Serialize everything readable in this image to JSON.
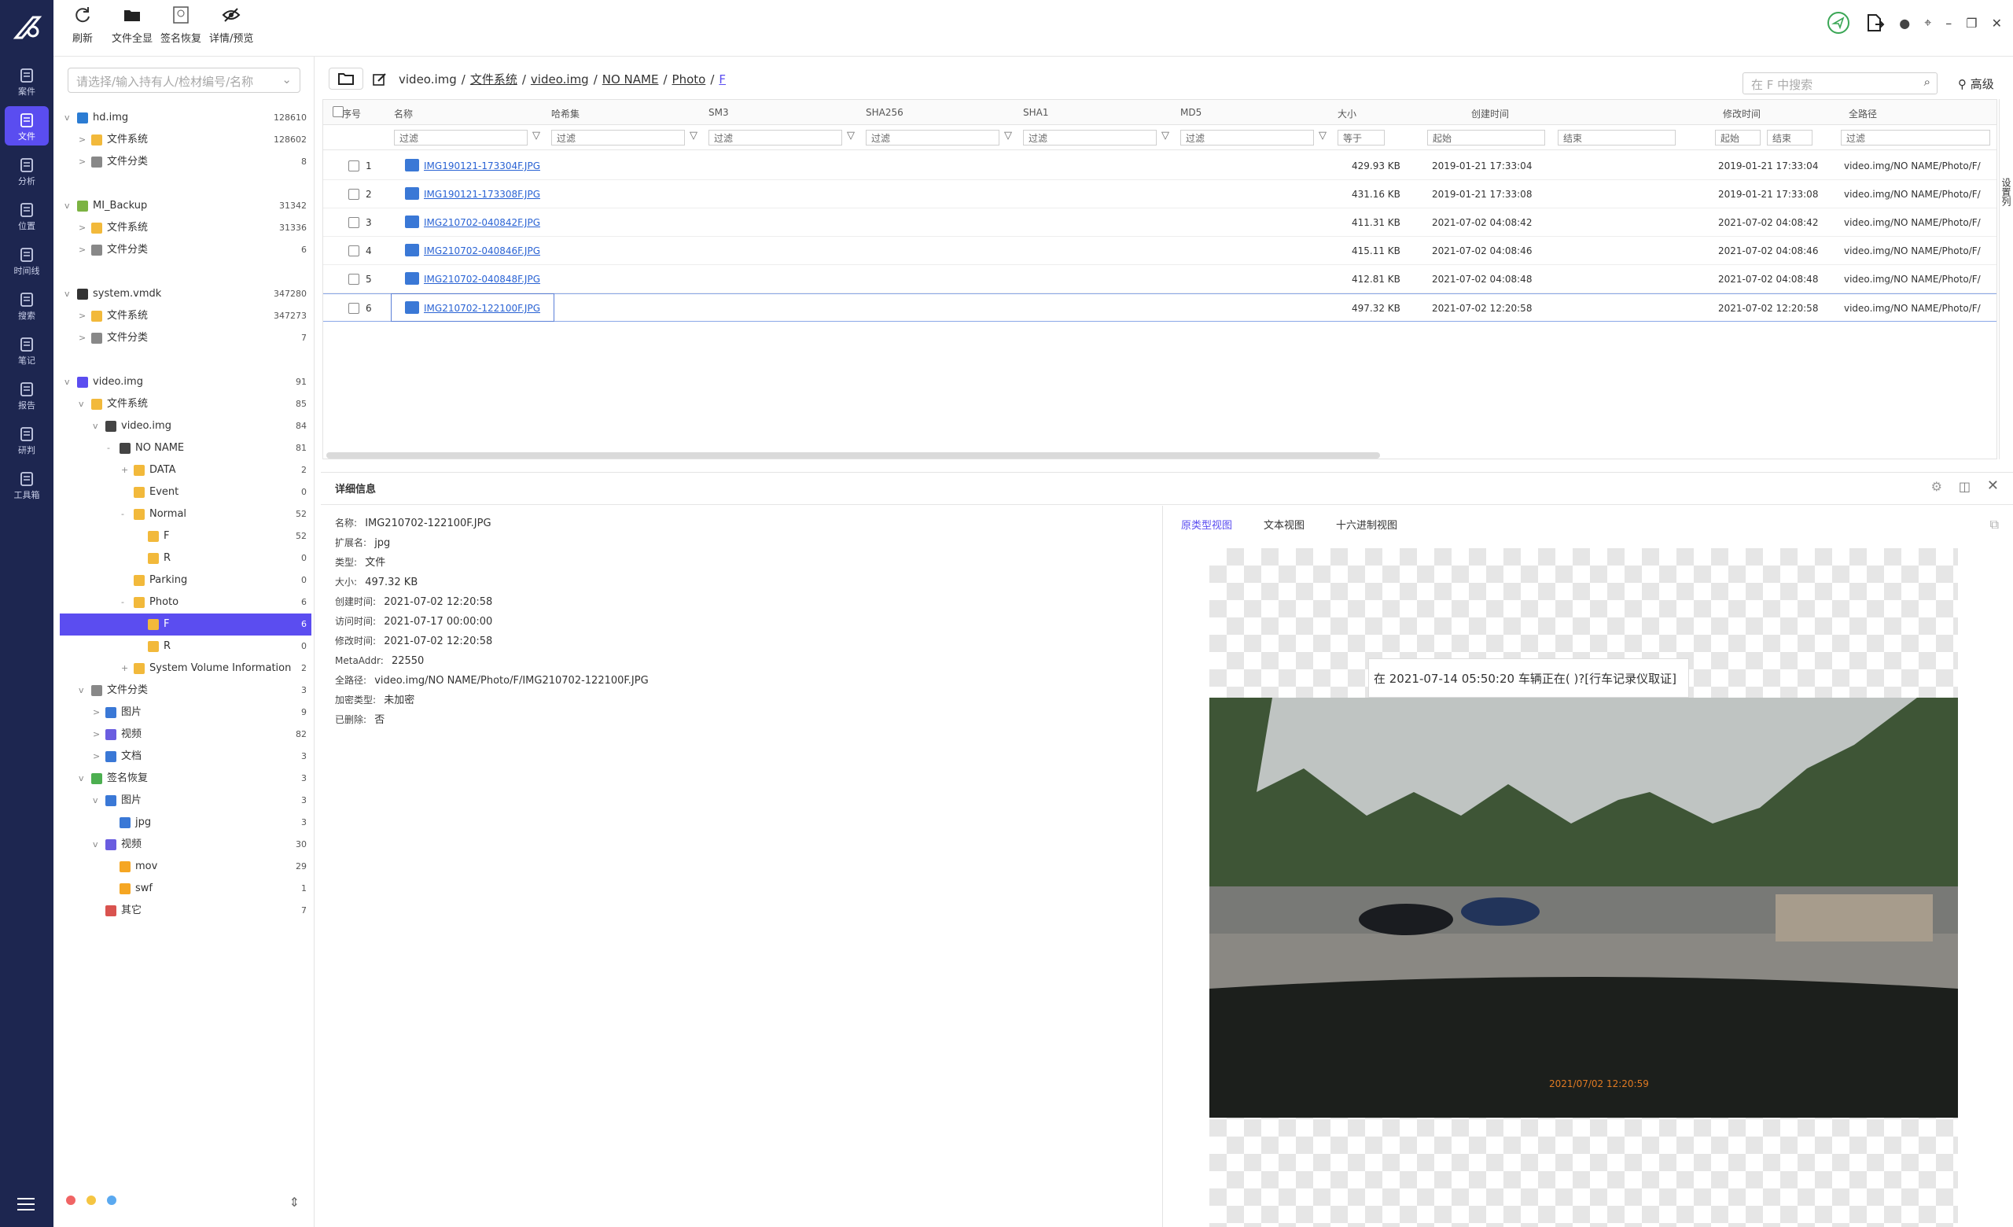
{
  "nav": [
    {
      "label": "案件",
      "icon": "case-icon"
    },
    {
      "label": "文件",
      "icon": "file-icon",
      "active": true
    },
    {
      "label": "分析",
      "icon": "analyze-icon"
    },
    {
      "label": "位置",
      "icon": "location-icon"
    },
    {
      "label": "时间线",
      "icon": "timeline-icon"
    },
    {
      "label": "搜索",
      "icon": "search-icon"
    },
    {
      "label": "笔记",
      "icon": "note-icon"
    },
    {
      "label": "报告",
      "icon": "report-icon"
    },
    {
      "label": "研判",
      "icon": "judge-icon"
    },
    {
      "label": "工具箱",
      "icon": "toolbox-icon"
    }
  ],
  "toolbar": {
    "refresh": "刷新",
    "show_all": "文件全显",
    "sig_recover": "签名恢复",
    "detail_preview": "详情/预览"
  },
  "side": {
    "placeholder": "请选择/输入持有人/检材编号/名称",
    "tree": [
      {
        "label": "hd.img",
        "count": "128610",
        "indent": 0,
        "tg": "v",
        "icon": "win"
      },
      {
        "label": "文件系统",
        "count": "128602",
        "indent": 1,
        "tg": ">",
        "icon": "folder"
      },
      {
        "label": "文件分类",
        "count": "8",
        "indent": 1,
        "tg": ">",
        "icon": "doc"
      },
      {
        "label": "",
        "count": "",
        "indent": 0,
        "tg": "",
        "icon": ""
      },
      {
        "label": "MI_Backup",
        "count": "31342",
        "indent": 0,
        "tg": "v",
        "icon": "android"
      },
      {
        "label": "文件系统",
        "count": "31336",
        "indent": 1,
        "tg": ">",
        "icon": "folder"
      },
      {
        "label": "文件分类",
        "count": "6",
        "indent": 1,
        "tg": ">",
        "icon": "doc"
      },
      {
        "label": "",
        "count": "",
        "indent": 0,
        "tg": "",
        "icon": ""
      },
      {
        "label": "system.vmdk",
        "count": "347280",
        "indent": 0,
        "tg": "v",
        "icon": "linux"
      },
      {
        "label": "文件系统",
        "count": "347273",
        "indent": 1,
        "tg": ">",
        "icon": "folder"
      },
      {
        "label": "文件分类",
        "count": "7",
        "indent": 1,
        "tg": ">",
        "icon": "doc"
      },
      {
        "label": "",
        "count": "",
        "indent": 0,
        "tg": "",
        "icon": ""
      },
      {
        "label": "video.img",
        "count": "91",
        "indent": 0,
        "tg": "v",
        "icon": "disk"
      },
      {
        "label": "文件系统",
        "count": "85",
        "indent": 1,
        "tg": "v",
        "icon": "folder"
      },
      {
        "label": "video.img",
        "count": "84",
        "indent": 2,
        "tg": "v",
        "icon": "drive"
      },
      {
        "label": "NO NAME",
        "count": "81",
        "indent": 3,
        "tg": "-",
        "icon": "drive"
      },
      {
        "label": "DATA",
        "count": "2",
        "indent": 4,
        "tg": "+",
        "icon": "folder"
      },
      {
        "label": "Event",
        "count": "0",
        "indent": 4,
        "tg": "",
        "icon": "folder"
      },
      {
        "label": "Normal",
        "count": "52",
        "indent": 4,
        "tg": "-",
        "icon": "folder"
      },
      {
        "label": "F",
        "count": "52",
        "indent": 5,
        "tg": "",
        "icon": "folder"
      },
      {
        "label": "R",
        "count": "0",
        "indent": 5,
        "tg": "",
        "icon": "folder"
      },
      {
        "label": "Parking",
        "count": "0",
        "indent": 4,
        "tg": "",
        "icon": "folder"
      },
      {
        "label": "Photo",
        "count": "6",
        "indent": 4,
        "tg": "-",
        "icon": "folder"
      },
      {
        "label": "F",
        "count": "6",
        "indent": 5,
        "tg": "",
        "icon": "folder",
        "selected": true
      },
      {
        "label": "R",
        "count": "0",
        "indent": 5,
        "tg": "",
        "icon": "folder"
      },
      {
        "label": "System Volume Information",
        "count": "2",
        "indent": 4,
        "tg": "+",
        "icon": "folder"
      },
      {
        "label": "文件分类",
        "count": "3",
        "indent": 1,
        "tg": "v",
        "icon": "doc"
      },
      {
        "label": "图片",
        "count": "9",
        "indent": 2,
        "tg": ">",
        "icon": "image"
      },
      {
        "label": "视频",
        "count": "82",
        "indent": 2,
        "tg": ">",
        "icon": "video"
      },
      {
        "label": "文档",
        "count": "3",
        "indent": 2,
        "tg": ">",
        "icon": "docblue"
      },
      {
        "label": "签名恢复",
        "count": "3",
        "indent": 1,
        "tg": "v",
        "icon": "sig"
      },
      {
        "label": "图片",
        "count": "3",
        "indent": 2,
        "tg": "v",
        "icon": "image"
      },
      {
        "label": "jpg",
        "count": "3",
        "indent": 3,
        "tg": "",
        "icon": "image"
      },
      {
        "label": "视频",
        "count": "30",
        "indent": 2,
        "tg": "v",
        "icon": "video"
      },
      {
        "label": "mov",
        "count": "29",
        "indent": 3,
        "tg": "",
        "icon": "orange"
      },
      {
        "label": "swf",
        "count": "1",
        "indent": 3,
        "tg": "",
        "icon": "orange"
      },
      {
        "label": "其它",
        "count": "7",
        "indent": 2,
        "tg": "",
        "icon": "red"
      }
    ]
  },
  "path": {
    "parts": [
      "video.img",
      "/",
      "文件系统",
      "/",
      "video.img",
      "/",
      "NO NAME",
      "/",
      "Photo",
      "/",
      "F"
    ],
    "search_placeholder": "在 F 中搜索",
    "advanced": "高级"
  },
  "grid": {
    "headers": [
      "序号",
      "名称",
      "哈希集",
      "SM3",
      "SHA256",
      "SHA1",
      "MD5",
      "大小",
      "创建时间",
      "修改时间",
      "全路径"
    ],
    "filter": "过滤",
    "eq": "等于",
    "start": "起始",
    "end": "结束",
    "rows": [
      {
        "idx": "1",
        "name": "IMG190121-173304F.JPG",
        "size": "429.93 KB",
        "ctime": "2019-01-21 17:33:04",
        "mtime": "2019-01-21 17:33:04",
        "path": "video.img/NO NAME/Photo/F/"
      },
      {
        "idx": "2",
        "name": "IMG190121-173308F.JPG",
        "size": "431.16 KB",
        "ctime": "2019-01-21 17:33:08",
        "mtime": "2019-01-21 17:33:08",
        "path": "video.img/NO NAME/Photo/F/"
      },
      {
        "idx": "3",
        "name": "IMG210702-040842F.JPG",
        "size": "411.31 KB",
        "ctime": "2021-07-02 04:08:42",
        "mtime": "2021-07-02 04:08:42",
        "path": "video.img/NO NAME/Photo/F/"
      },
      {
        "idx": "4",
        "name": "IMG210702-040846F.JPG",
        "size": "415.11 KB",
        "ctime": "2021-07-02 04:08:46",
        "mtime": "2021-07-02 04:08:46",
        "path": "video.img/NO NAME/Photo/F/"
      },
      {
        "idx": "5",
        "name": "IMG210702-040848F.JPG",
        "size": "412.81 KB",
        "ctime": "2021-07-02 04:08:48",
        "mtime": "2021-07-02 04:08:48",
        "path": "video.img/NO NAME/Photo/F/"
      },
      {
        "idx": "6",
        "name": "IMG210702-122100F.JPG",
        "size": "497.32 KB",
        "ctime": "2021-07-02 12:20:58",
        "mtime": "2021-07-02 12:20:58",
        "path": "video.img/NO NAME/Photo/F/",
        "selected": true
      }
    ]
  },
  "detail": {
    "title": "详细信息",
    "fields": [
      {
        "k": "名称:",
        "v": "IMG210702-122100F.JPG"
      },
      {
        "k": "扩展名:",
        "v": "jpg"
      },
      {
        "k": "类型:",
        "v": "文件"
      },
      {
        "k": "大小:",
        "v": "497.32 KB"
      },
      {
        "k": "创建时间:",
        "v": "2021-07-02 12:20:58"
      },
      {
        "k": "访问时间:",
        "v": "2021-07-17 00:00:00"
      },
      {
        "k": "修改时间:",
        "v": "2021-07-02 12:20:58"
      },
      {
        "k": "MetaAddr:",
        "v": "22550"
      },
      {
        "k": "全路径:",
        "v": "video.img/NO NAME/Photo/F/IMG210702-122100F.JPG"
      },
      {
        "k": "加密类型:",
        "v": "未加密"
      },
      {
        "k": "已删除:",
        "v": "否"
      }
    ],
    "tabs": [
      "原类型视图",
      "文本视图",
      "十六进制视图"
    ],
    "tooltip": "在 2021-07-14 05:50:20 车辆正在( )?[行车记录仪取证]",
    "stamp": "2021/07/02 12:20:59",
    "vertical_tab": "设置列"
  },
  "colors": {
    "nav_bg": "#1d2650",
    "accent": "#5b4df0",
    "link": "#2a63d4"
  }
}
